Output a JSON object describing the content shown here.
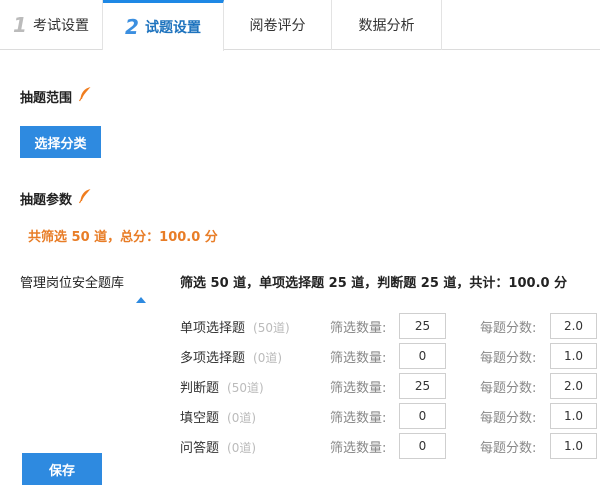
{
  "tabs": [
    {
      "num": "1",
      "label": "考试设置"
    },
    {
      "num": "2",
      "label": "试题设置"
    },
    {
      "num": "",
      "label": "阅卷评分"
    },
    {
      "num": "",
      "label": "数据分析"
    }
  ],
  "draw_scope": {
    "title": "抽题范围",
    "button": "选择分类"
  },
  "draw_params": {
    "title": "抽题参数",
    "summary": "共筛选 50 道，总分：100.0 分"
  },
  "bank": {
    "name": "管理岗位安全题库",
    "summary": "筛选 50 道，单项选择题 25 道，判断题 25 道，共计：100.0 分",
    "filter_label": "筛选数量:",
    "score_label": "每题分数:",
    "rows": [
      {
        "type": "单项选择题",
        "available": "(50道)",
        "count": "25",
        "score": "2.0"
      },
      {
        "type": "多项选择题",
        "available": "(0道)",
        "count": "0",
        "score": "1.0"
      },
      {
        "type": "判断题",
        "available": "(50道)",
        "count": "25",
        "score": "2.0"
      },
      {
        "type": "填空题",
        "available": "(0道)",
        "count": "0",
        "score": "1.0"
      },
      {
        "type": "问答题",
        "available": "(0道)",
        "count": "0",
        "score": "1.0"
      }
    ]
  },
  "save_label": "保存",
  "colors": {
    "accent": "#2e8ae0",
    "highlight": "#e87d27"
  },
  "icons": {
    "edit": "feather-icon"
  }
}
